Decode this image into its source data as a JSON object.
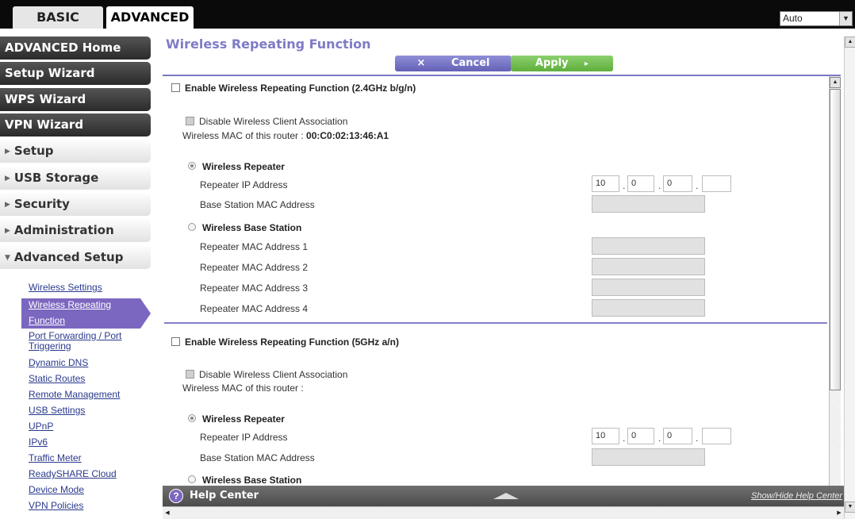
{
  "top_tabs": {
    "basic": "BASIC",
    "advanced": "ADVANCED"
  },
  "language": {
    "selected": "Auto"
  },
  "sidebar": {
    "main_buttons": [
      "ADVANCED Home",
      "Setup Wizard",
      "WPS Wizard",
      "VPN Wizard"
    ],
    "sections": [
      "Setup",
      "USB Storage",
      "Security",
      "Administration",
      "Advanced Setup"
    ],
    "sub_items": [
      "Wireless Settings",
      "Wireless Repeating",
      "Function",
      "Port Forwarding / Port",
      "Triggering",
      "Dynamic DNS",
      "Static Routes",
      "Remote Management",
      "USB Settings",
      "UPnP",
      "IPv6",
      "Traffic Meter",
      "ReadySHARE Cloud",
      "Device Mode",
      "VPN Policies"
    ]
  },
  "page": {
    "title": "Wireless Repeating Function",
    "cancel_label": "Cancel",
    "cancel_icon": "×",
    "apply_label": "Apply",
    "apply_icon": "▸"
  },
  "band24": {
    "enable_label": "Enable Wireless Repeating Function (2.4GHz b/g/n)",
    "disable_assoc_label": "Disable Wireless Client Association",
    "mac_label": "Wireless MAC of this router :",
    "mac_value": "00:C0:02:13:46:A1",
    "repeater_label": "Wireless Repeater",
    "repeater_ip_label": "Repeater IP Address",
    "ip": [
      "10",
      "0",
      "0",
      ""
    ],
    "base_mac_label": "Base Station MAC Address",
    "base_station_label": "Wireless Base Station",
    "repeater_macs": [
      "Repeater MAC Address 1",
      "Repeater MAC Address 2",
      "Repeater MAC Address 3",
      "Repeater MAC Address 4"
    ]
  },
  "band5": {
    "enable_label": "Enable Wireless Repeating Function (5GHz a/n)",
    "disable_assoc_label": "Disable Wireless Client Association",
    "mac_label": "Wireless MAC of this router :",
    "repeater_label": "Wireless Repeater",
    "repeater_ip_label": "Repeater IP Address",
    "ip": [
      "10",
      "0",
      "0",
      ""
    ],
    "base_mac_label": "Base Station MAC Address",
    "base_station_label": "Wireless Base Station"
  },
  "help": {
    "label": "Help Center",
    "icon": "?",
    "toggle_label": "Show/Hide Help Center"
  }
}
